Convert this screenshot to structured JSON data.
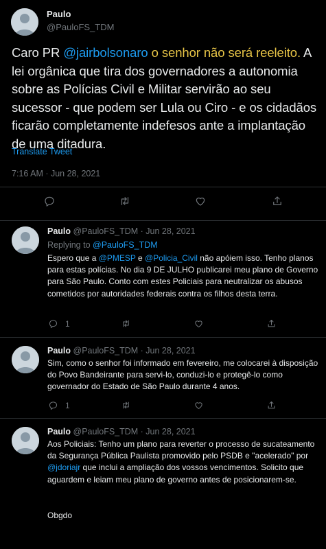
{
  "main_tweet": {
    "name": "Paulo",
    "handle": "@PauloFS_TDM",
    "text_intro": "Caro PR ",
    "mention": "@jairbolsonaro",
    "text_highlight": " o senhor não será reeleito.",
    "text_rest": " A lei orgânica que tira dos governadores a autonomia sobre as Polícias Civil e Militar servirão ao seu sucessor - que podem ser Lula ou Ciro - e os cidadãos ficarão completamente indefesos ante a implantação de uma ditadura.",
    "translate": "Translate Tweet",
    "timestamp": "7:16 AM · Jun 28, 2021",
    "actions": [
      "reply-icon",
      "retweet-icon",
      "like-icon",
      "share-icon"
    ]
  },
  "replies": [
    {
      "name": "Paulo",
      "meta": "@PauloFS_TDM · Jun 28, 2021",
      "replying_label": "Replying to ",
      "replying_handle": "@PauloFS_TDM",
      "text_a": "Espero que a ",
      "mention_a": "@PMESP",
      "text_b": " e ",
      "mention_b": "@Policia_Civil",
      "text_c": " não apóiem isso. Tenho planos para estas polícias. No dia 9 DE JULHO publicarei meu plano de Governo para São Paulo. Conto com estes Policiais para neutralizar os abusos cometidos por autoridades federais contra os filhos desta terra.",
      "reply_count": "1"
    },
    {
      "name": "Paulo",
      "meta": "@PauloFS_TDM · Jun 28, 2021",
      "text": "Sim, como o senhor foi informado em fevereiro, me colocarei à disposição do Povo Bandeirante para servi-lo, conduzi-lo e protegê-lo como governador do Estado de São Paulo durante 4 anos.",
      "reply_count": "1"
    },
    {
      "name": "Paulo",
      "meta": "@PauloFS_TDM · Jun 28, 2021",
      "text_a": "Aos Policiais: Tenho um plano para reverter o processo de sucateamento da Segurança Pública Paulista promovido pelo PSDB e \"acelerado\" por ",
      "mention": "@jdoriajr",
      "text_b": " que inclui a ampliação dos vossos vencimentos. Solicito que aguardem e leiam meu plano de governo antes de posicionarem-se.",
      "signoff": "Obgdo"
    }
  ]
}
